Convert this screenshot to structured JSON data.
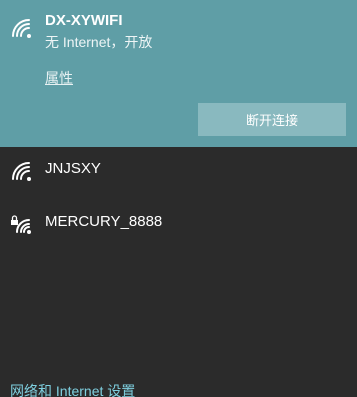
{
  "active_network": {
    "ssid": "DX-XYWIFI",
    "status": "无 Internet，开放",
    "properties_link": "属性",
    "disconnect_label": "断开连接",
    "icon": "wifi-signal-icon",
    "background": "#5f9ea6"
  },
  "networks": [
    {
      "ssid": "JNJSXY",
      "icon": "wifi-signal-icon",
      "secured": false
    },
    {
      "ssid": "MERCURY_8888",
      "icon": "wifi-secured-icon",
      "secured": true
    }
  ],
  "footer": {
    "settings_link": "网络和 Internet 设置"
  },
  "colors": {
    "panel": "#2b2b2b",
    "accent_link": "#7fd0e0",
    "button": "#89b9bf"
  }
}
